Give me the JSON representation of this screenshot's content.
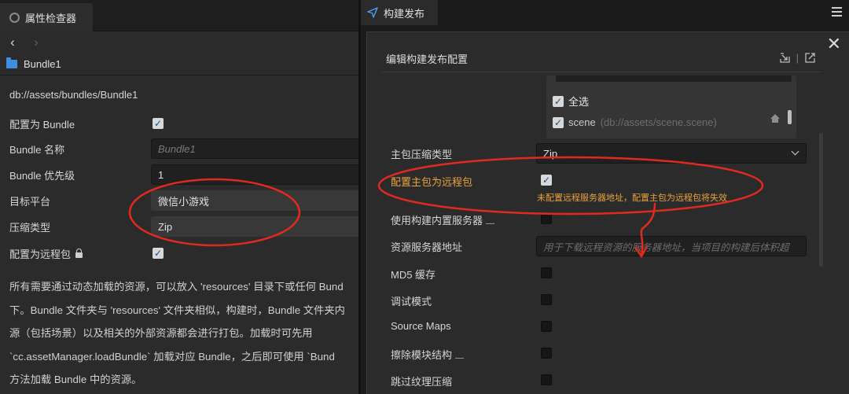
{
  "inspector": {
    "tab_label": "属性检查器",
    "asset_name": "Bundle1",
    "path": "db://assets/bundles/Bundle1",
    "fields": {
      "config_bundle_label": "配置为 Bundle",
      "bundle_name_label": "Bundle 名称",
      "bundle_name_placeholder": "Bundle1",
      "bundle_priority_label": "Bundle 优先级",
      "bundle_priority_value": "1",
      "target_platform_label": "目标平台",
      "target_platform_value": "微信小游戏",
      "compression_label": "压缩类型",
      "compression_value": "Zip",
      "remote_label": "配置为远程包"
    },
    "description_lines": [
      "所有需要通过动态加载的资源，可以放入 'resources' 目录下或任何 Bund",
      "下。Bundle 文件夹与 'resources' 文件夹相似，构建时，Bundle 文件夹内",
      "源（包括场景）以及相关的外部资源都会进行打包。加载时可先用",
      "`cc.assetManager.loadBundle` 加载对应 Bundle，之后即可使用 `Bund",
      "方法加载 Bundle 中的资源。"
    ]
  },
  "build": {
    "tab_label": "构建发布",
    "dialog_title": "编辑构建发布配置",
    "select_all_label": "全选",
    "scene_name": "scene",
    "scene_path": "(db://assets/scene.scene)",
    "main_compress_label": "主包压缩类型",
    "main_compress_value": "Zip",
    "main_remote_label": "配置主包为远程包",
    "warning": "未配置远程服务器地址，配置主包为远程包将失效",
    "builtin_server_label": "使用构建内置服务器",
    "server_address_label": "资源服务器地址",
    "server_address_placeholder": "用于下载远程资源的服务器地址，当项目的构建后体积超",
    "md5_label": "MD5 缓存",
    "debug_label": "调试模式",
    "source_maps_label": "Source Maps",
    "erase_modules_label": "擦除模块结构",
    "skip_texture_label": "跳过纹理压缩"
  },
  "colors": {
    "annotation": "#e02a1f",
    "warning_text": "#e8a33d",
    "folder": "#3f8fe0"
  }
}
